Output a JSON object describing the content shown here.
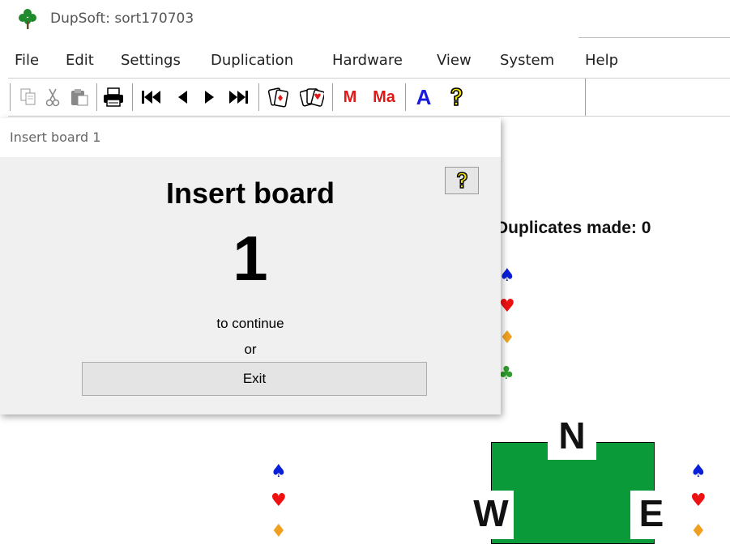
{
  "window": {
    "title": "DupSoft: sort170703",
    "icon": "clover-icon"
  },
  "menu": [
    {
      "label": "File"
    },
    {
      "label": "Edit"
    },
    {
      "label": "Settings"
    },
    {
      "label": "Duplication"
    },
    {
      "label": "Hardware"
    },
    {
      "label": "View"
    },
    {
      "label": "System"
    },
    {
      "label": "Help"
    }
  ],
  "toolbar": {
    "buttons": [
      {
        "name": "copy-icon"
      },
      {
        "name": "cut-icon"
      },
      {
        "name": "paste-icon"
      },
      {
        "name": "print-icon"
      },
      {
        "name": "first-icon"
      },
      {
        "name": "previous-icon"
      },
      {
        "name": "next-icon"
      },
      {
        "name": "last-icon"
      },
      {
        "name": "deal-icon"
      },
      {
        "name": "cards-icon"
      },
      {
        "name": "M",
        "color": "#e01818"
      },
      {
        "name": "Ma",
        "color": "#e01818"
      },
      {
        "name": "A",
        "color": "#1a1adf"
      },
      {
        "name": "help-icon"
      }
    ]
  },
  "background": {
    "duplicates_made": "Duplicates made: 0",
    "compass": {
      "north": "N",
      "west": "W",
      "east": "E"
    }
  },
  "dialog": {
    "title": "Insert board 1",
    "heading": "Insert board",
    "board_number": "1",
    "continue_text": "to continue",
    "or_text": "or",
    "exit_label": "Exit",
    "help_icon": "help-question-icon"
  },
  "colors": {
    "spade": "#0a1fd8",
    "heart": "#ee1111",
    "diamond": "#f0a020",
    "club": "#2e9d2e",
    "table": "#0b9a3a"
  }
}
